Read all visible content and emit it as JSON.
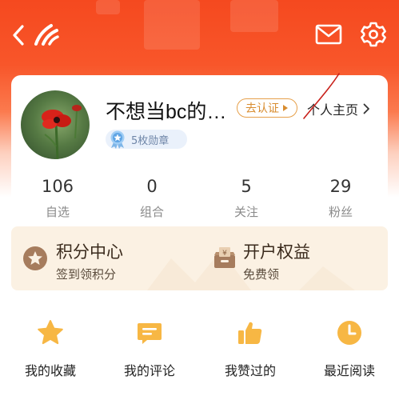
{
  "topbar": {
    "back_icon": "chevron-left-icon",
    "logo_icon": "brand-logo-icon",
    "mail_icon": "mail-icon",
    "settings_icon": "gear-icon"
  },
  "profile": {
    "username": "不想当bc的…",
    "verify_label": "去认证",
    "homepage_label": "个人主页",
    "badge_label": "5枚勋章"
  },
  "stats": [
    {
      "value": "106",
      "label": "自选"
    },
    {
      "value": "0",
      "label": "组合"
    },
    {
      "value": "5",
      "label": "关注"
    },
    {
      "value": "29",
      "label": "粉丝"
    }
  ],
  "perks": {
    "points": {
      "title": "积分中心",
      "subtitle": "签到领积分",
      "icon": "star-coin-icon"
    },
    "account": {
      "title": "开户权益",
      "subtitle": "免费领",
      "icon": "yuan-wallet-icon"
    }
  },
  "shortcuts": [
    {
      "label": "我的收藏",
      "icon": "star-icon"
    },
    {
      "label": "我的评论",
      "icon": "comment-icon"
    },
    {
      "label": "我赞过的",
      "icon": "thumbs-up-icon"
    },
    {
      "label": "最近阅读",
      "icon": "clock-icon"
    }
  ],
  "colors": {
    "header_orange": "#f5491f",
    "verify_gold": "#d88c2f",
    "shortcut_icon": "#f7b744",
    "perk_bg": "#fbf1e3"
  }
}
